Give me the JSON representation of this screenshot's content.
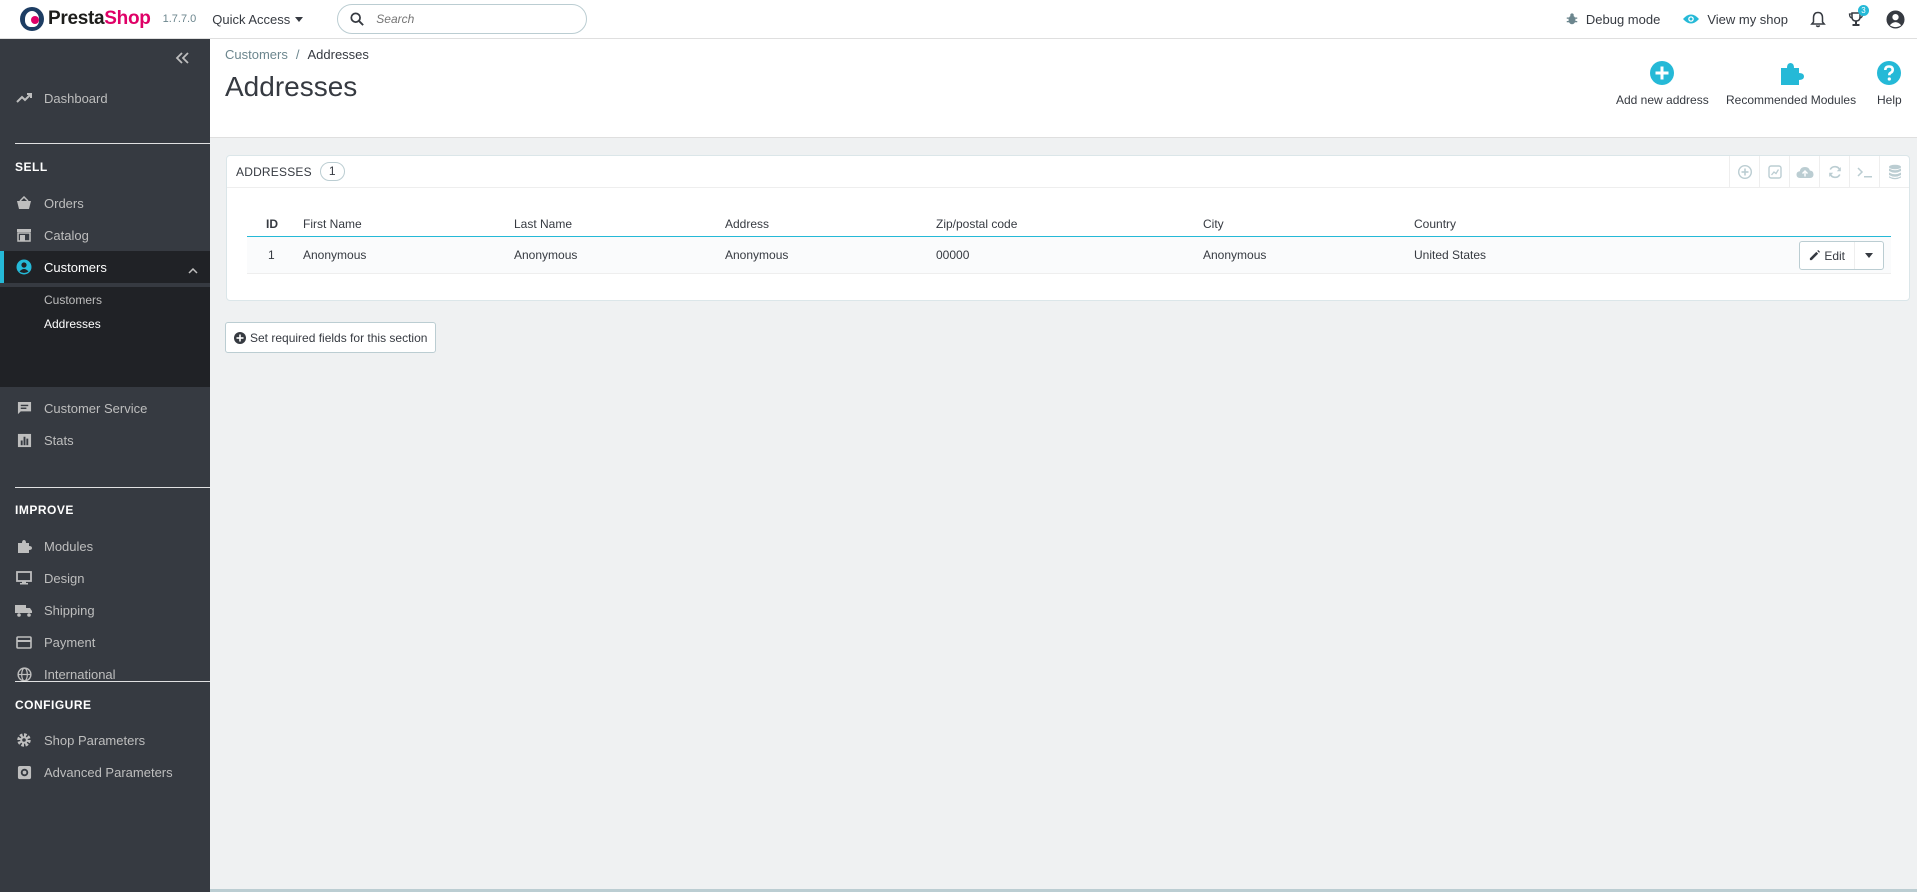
{
  "header": {
    "logo_text_dark": "Presta",
    "logo_text_pink": "Shop",
    "version": "1.7.7.0",
    "quick_access": "Quick Access",
    "search_placeholder": "Search",
    "debug_mode": "Debug mode",
    "view_shop": "View my shop",
    "trophy_count": "3"
  },
  "sidebar": {
    "dashboard": "Dashboard",
    "sell_title": "SELL",
    "orders": "Orders",
    "catalog": "Catalog",
    "customers": "Customers",
    "sub_customers": "Customers",
    "sub_addresses": "Addresses",
    "customer_service": "Customer Service",
    "stats": "Stats",
    "improve_title": "IMPROVE",
    "modules": "Modules",
    "design": "Design",
    "shipping": "Shipping",
    "payment": "Payment",
    "international": "International",
    "configure_title": "CONFIGURE",
    "shop_parameters": "Shop Parameters",
    "advanced_parameters": "Advanced Parameters"
  },
  "page": {
    "breadcrumb_parent": "Customers",
    "breadcrumb_sep": "/",
    "breadcrumb_current": "Addresses",
    "title": "Addresses",
    "add_new": "Add new address",
    "recommended": "Recommended Modules",
    "help": "Help"
  },
  "panel": {
    "title": "ADDRESSES",
    "count": "1",
    "columns": {
      "id": "ID",
      "first_name": "First Name",
      "last_name": "Last Name",
      "address": "Address",
      "zip": "Zip/postal code",
      "city": "City",
      "country": "Country"
    },
    "rows": [
      {
        "id": "1",
        "first_name": "Anonymous",
        "last_name": "Anonymous",
        "address": "Anonymous",
        "zip": "00000",
        "city": "Anonymous",
        "country": "United States"
      }
    ],
    "edit_label": "Edit"
  },
  "required_fields_label": "Set required fields for this section",
  "colors": {
    "accent": "#25b9d7",
    "sidebar_bg": "#363a41",
    "sidebar_active_bg": "#202226",
    "brand_pink": "#df0067"
  }
}
